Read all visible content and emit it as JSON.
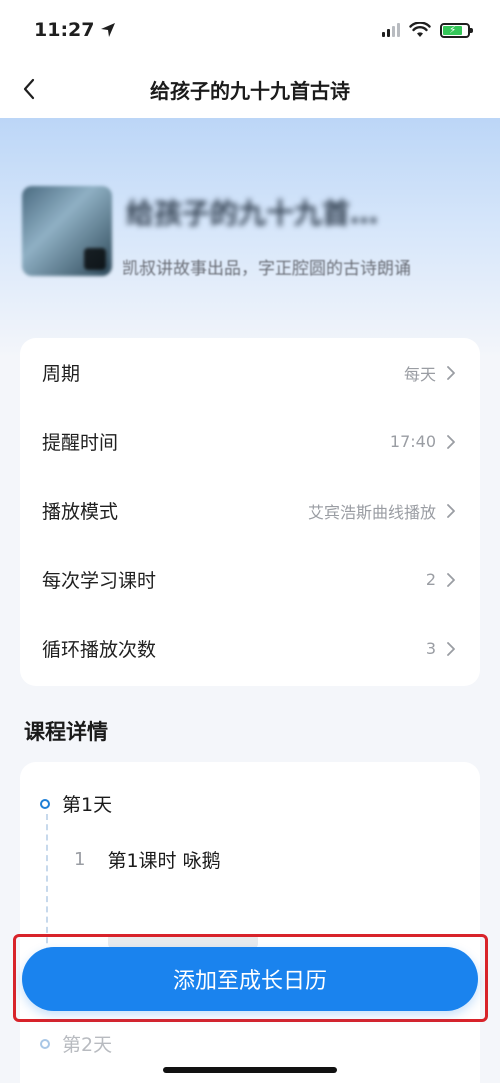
{
  "status_bar": {
    "time": "11:27",
    "battery_glyph": "⚡"
  },
  "nav": {
    "title": "给孩子的九十九首古诗"
  },
  "course": {
    "title": "给孩子的九十九首…",
    "description": "凯叔讲故事出品，字正腔圆的古诗朗诵"
  },
  "settings": [
    {
      "label": "周期",
      "value": "每天"
    },
    {
      "label": "提醒时间",
      "value": "17:40"
    },
    {
      "label": "播放模式",
      "value": "艾宾浩斯曲线播放"
    },
    {
      "label": "每次学习课时",
      "value": "2"
    },
    {
      "label": "循环播放次数",
      "value": "3"
    }
  ],
  "details": {
    "section_title": "课程详情",
    "day1_label": "第1天",
    "lesson1_num": "1",
    "lesson1_title": "第1课时 咏鹅",
    "day2_label": "第2天"
  },
  "cta": {
    "label": "添加至成长日历"
  },
  "colors": {
    "accent": "#1a83ee",
    "highlight_frame": "#d8232a"
  }
}
